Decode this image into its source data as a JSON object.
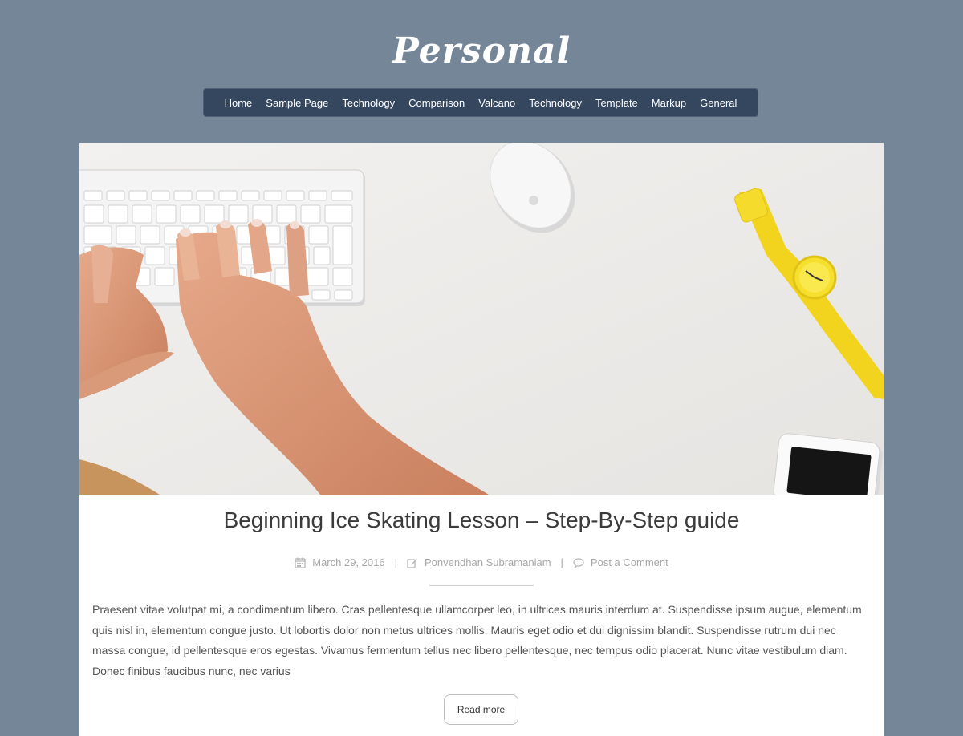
{
  "site": {
    "title": "Personal"
  },
  "nav": {
    "items": [
      "Home",
      "Sample Page",
      "Technology",
      "Comparison",
      "Valcano",
      "Technology",
      "Template",
      "Markup",
      "General"
    ]
  },
  "post": {
    "title": "Beginning Ice Skating Lesson – Step-By-Step guide",
    "date": "March 29, 2016",
    "author": "Ponvendhan Subramaniam",
    "comment_link": "Post a Comment",
    "separator": "|",
    "excerpt": "Praesent vitae volutpat mi, a condimentum libero. Cras pellentesque ullamcorper leo, in ultrices mauris interdum at. Suspendisse ipsum augue, elementum quis nisl in, elementum congue justo. Ut lobortis dolor non metus ultrices mollis. Mauris eget odio et dui dignissim blandit. Suspendisse rutrum dui nec massa congue, id pellentesque eros egestas. Vivamus fermentum tellus nec libero pellentesque, nec tempus odio placerat. Nunc vitae vestibulum diam. Donec finibus faucibus nunc, nec varius",
    "read_more": "Read more"
  },
  "colors": {
    "background": "#758698",
    "nav_bg": "#34475e",
    "watch_yellow": "#f2d41f"
  },
  "icons": {
    "date": "calendar-icon",
    "author": "edit-icon",
    "comment": "comment-icon"
  }
}
